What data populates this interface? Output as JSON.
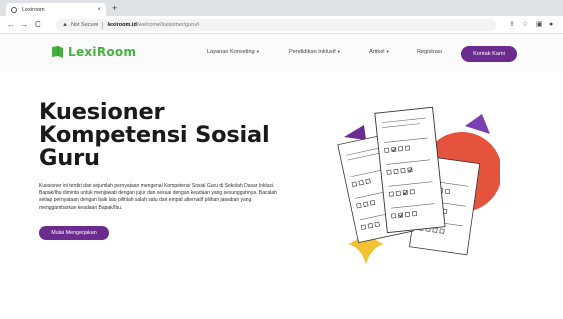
{
  "browser": {
    "tab_title": "Lexiroom",
    "tab_close": "×",
    "new_tab": "+",
    "back": "←",
    "forward": "→",
    "reload": "C",
    "security_label": "Not Secure",
    "url_host": "lexiroom.id",
    "url_path": "/welcome/kuisioner/guru#"
  },
  "header": {
    "logo_text": "LexiRoom",
    "nav": [
      {
        "label": "Layanan Konseling",
        "caret": "▾"
      },
      {
        "label": "Pendidikan Inklusif",
        "caret": "▾"
      },
      {
        "label": "Artikel",
        "caret": "▾"
      },
      {
        "label": "Registrasi"
      }
    ],
    "cta_label": "Kontak Kami",
    "colors": {
      "brand_green": "#45b23f",
      "accent_purple": "#6b2b8f"
    }
  },
  "hero": {
    "title_lines": [
      "Kuesioner",
      "Kompetensi Sosial",
      "Guru"
    ],
    "description": "Kuesioner ini terdiri dari sejumlah pernyataan mengenai Kompetensi Sosial Guru di Sekolah Dasar Inklusi. Bapak/Ibu diminta untuk menjawab dengan jujur dan sesuai dengan keadaan yang sesungguhnya. Bacalah setiap pernyataan dengan baik lalu pilihlah salah satu dari empat alternatif pilihan jawaban yang menggambarkan keadaan Bapak/Ibu.",
    "button_label": "Mulai Mengerjakan"
  }
}
